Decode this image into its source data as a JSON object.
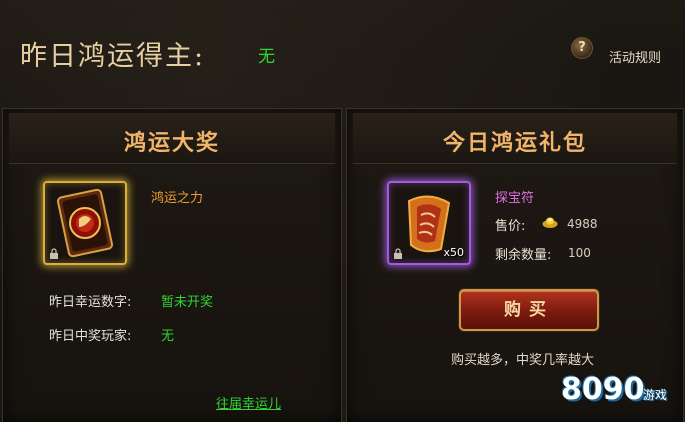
{
  "header": {
    "title": "昨日鸿运得主:",
    "winner": "无",
    "rules_label": "活动规则",
    "help_glyph": "?"
  },
  "left_panel": {
    "title": "鸿运大奖",
    "item_name": "鸿运之力",
    "lucky_number_label": "昨日幸运数字:",
    "lucky_number_value": "暂未开奖",
    "winner_label": "昨日中奖玩家:",
    "winner_value": "无",
    "history_link": "往届幸运儿"
  },
  "right_panel": {
    "title": "今日鸿运礼包",
    "item_name": "探宝符",
    "stack_count": "x50",
    "price_label": "售价:",
    "price_value": "4988",
    "remaining_label": "剩余数量:",
    "remaining_value": "100",
    "buy_label": "购买",
    "hint": "购买越多，中奖几率越大"
  },
  "watermark": {
    "digits": "8090",
    "text": "游戏"
  },
  "colors": {
    "accent_title": "#f0b46a",
    "green": "#33d433",
    "gold_frame": "#d9ae3a",
    "purple_frame": "#a15ae0"
  }
}
